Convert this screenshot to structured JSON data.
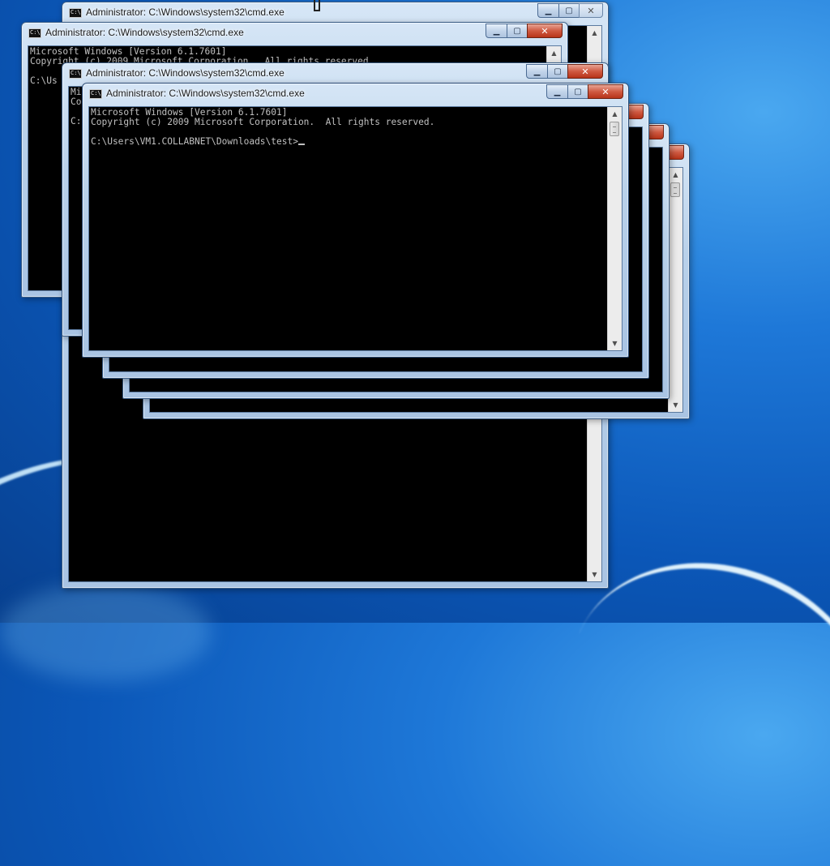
{
  "desktop": {
    "wallpaper": "Windows 7 default",
    "accent": "#0b57b8"
  },
  "windows": [
    {
      "id": "cmd-back-1",
      "title": "Administrator: C:\\Windows\\system32\\cmd.exe",
      "lines": []
    },
    {
      "id": "cmd-back-2",
      "title": "Administrator: C:\\Windows\\system32\\cmd.exe",
      "lines": [
        "Microsoft Windows [Version 6.1.7601]",
        "Copyright (c) 2009 Microsoft Corporation.  All rights reserved.",
        "",
        "C:\\Us"
      ]
    },
    {
      "id": "cmd-back-3",
      "title": "Administrator: C:\\Windows\\system32\\cmd.exe",
      "lines": [
        "Mi",
        "Co",
        "",
        "C:"
      ]
    },
    {
      "id": "cmd-back-4",
      "title": "",
      "lines": []
    },
    {
      "id": "cmd-back-5",
      "title": "",
      "lines": []
    },
    {
      "id": "cmd-back-6",
      "title": "",
      "lines": []
    },
    {
      "id": "cmd-active",
      "title": "Administrator: C:\\Windows\\system32\\cmd.exe",
      "lines": [
        "Microsoft Windows [Version 6.1.7601]",
        "Copyright (c) 2009 Microsoft Corporation.  All rights reserved.",
        ""
      ],
      "prompt": "C:\\Users\\VM1.COLLABNET\\Downloads\\test>"
    }
  ],
  "controls": {
    "minimize_icon": "minimize-icon",
    "maximize_icon": "maximize-icon",
    "close_icon": "close-icon"
  },
  "glyphs": {
    "minimize": "▁",
    "maximize": "▢",
    "close": "✕",
    "up": "▲",
    "down": "▼",
    "app_icon": "C:\\"
  }
}
